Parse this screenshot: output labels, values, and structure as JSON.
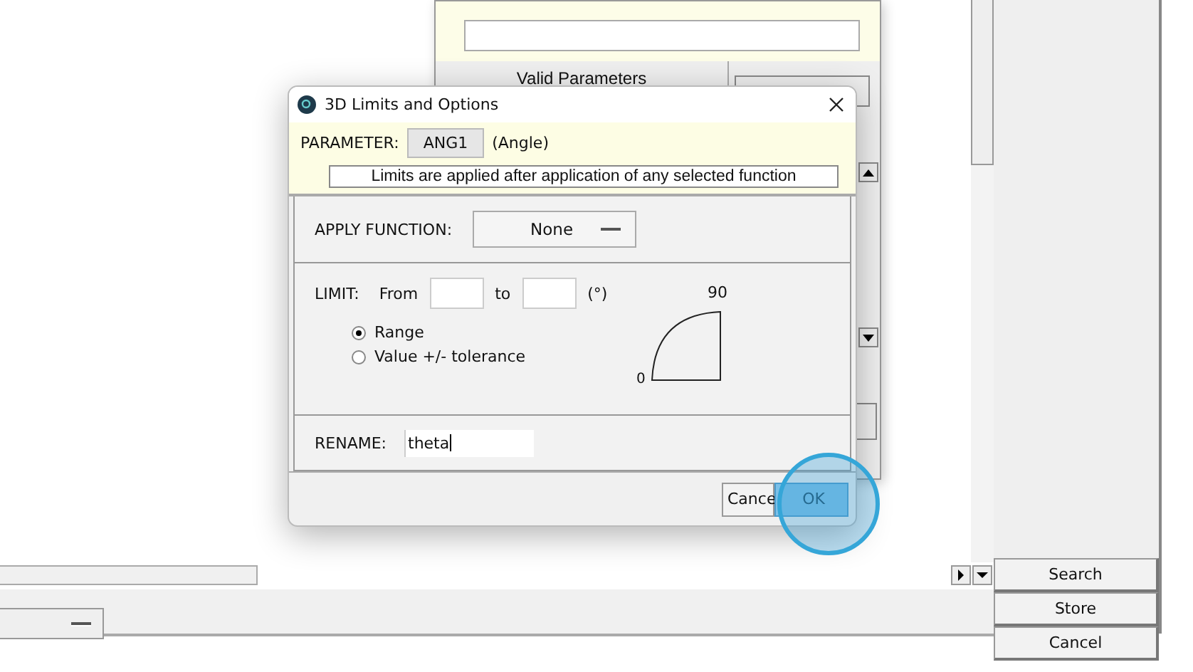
{
  "back_panel": {
    "header": "Valid Parameters"
  },
  "dialog": {
    "title": "3D Limits and Options",
    "parameter": {
      "label": "PARAMETER:",
      "value": "ANG1",
      "type": "(Angle)"
    },
    "note": "Limits are applied after application of any selected function",
    "apply_function": {
      "label": "APPLY FUNCTION:",
      "value": "None"
    },
    "limit": {
      "label": "LIMIT:",
      "from_label": "From",
      "to_label": "to",
      "unit": "(°)",
      "arc_min": "0",
      "arc_max": "90",
      "options": [
        {
          "label": "Range",
          "selected": true
        },
        {
          "label": "Value +/- tolerance",
          "selected": false
        }
      ]
    },
    "rename": {
      "label": "RENAME:",
      "value": "theta"
    },
    "buttons": [
      {
        "label": "Cance",
        "highlighted": false
      },
      {
        "label": "OK",
        "highlighted": true
      }
    ]
  },
  "side_buttons": [
    "Search",
    "Store",
    "Cancel"
  ]
}
